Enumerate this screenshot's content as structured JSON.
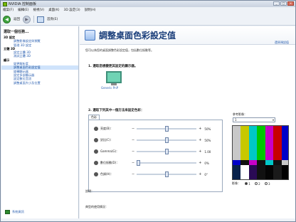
{
  "window": {
    "title": "NVIDIA 控制面板"
  },
  "menubar": {
    "items": [
      "檔案(F)",
      "編輯(E)",
      "檢視(V)",
      "桌面(K)",
      "3D 設定(3)",
      "說明(H)"
    ]
  },
  "toolbar": {
    "back_label": "返回",
    "home_label": "首頁(E)"
  },
  "sidebar": {
    "title": "選取一個任務...",
    "items": [
      {
        "label": "3D 設定",
        "level": 0
      },
      {
        "label": "調整影像設定與預覽",
        "level": 1
      },
      {
        "label": "管理 3D 設定",
        "level": 1
      },
      {
        "label": "立體 3D",
        "level": 0
      },
      {
        "label": "設定立體 3D",
        "level": 1
      },
      {
        "label": "測試立體 3D",
        "level": 1
      },
      {
        "label": "顯示",
        "level": 0
      },
      {
        "label": "變更解析度",
        "level": 1
      },
      {
        "label": "調整桌面色彩設定值",
        "level": 1,
        "selected": true
      },
      {
        "label": "旋轉顯示器",
        "level": 1
      },
      {
        "label": "設定多部顯示器",
        "level": 1
      },
      {
        "label": "設定數位音訊",
        "level": 1
      },
      {
        "label": "調整桌面大小及位置",
        "level": 1
      }
    ],
    "system_info": "系統資訊"
  },
  "main": {
    "title": "調整桌面色彩設定值",
    "restore_defaults": "還原預設值",
    "description": "您可以為您的桌面調整色彩設定值，包括數位振動等。",
    "step1": "1. 選取您想變更其設定的顯示器。",
    "monitor_label": "Generic PnP",
    "step2": "2. 選取下列其中一個方法來設定色彩：",
    "tab_label": "色彩",
    "sliders": [
      {
        "label": "亮度(B)：",
        "value_text": "50%",
        "fraction": 0.5
      },
      {
        "label": "對比(C)：",
        "value_text": "50%",
        "fraction": 0.5
      },
      {
        "label": "Gamma(G)：",
        "value_text": "1.00",
        "fraction": 0.5
      },
      {
        "label": "數位振動(D)：",
        "value_text": "0%",
        "fraction": 0.0
      },
      {
        "label": "色調(H)：",
        "value_text": "0°",
        "fraction": 0.5
      }
    ],
    "preview_label": "參考影像：",
    "preview_select": "1",
    "radio_label": "影像：",
    "radio_options": [
      "1",
      "2",
      "3"
    ],
    "instructions": "說明：",
    "typical_usage": "典型的使用情況："
  },
  "colors": {
    "accent": "#76b900",
    "link": "#2a5fb0",
    "title": "#1a3e7a"
  },
  "icons": {
    "app": "nvidia-logo",
    "back": "back-arrow",
    "forward": "forward-arrow",
    "home": "home-icon",
    "header": "display-color-icon",
    "system_info": "system-info-icon"
  }
}
